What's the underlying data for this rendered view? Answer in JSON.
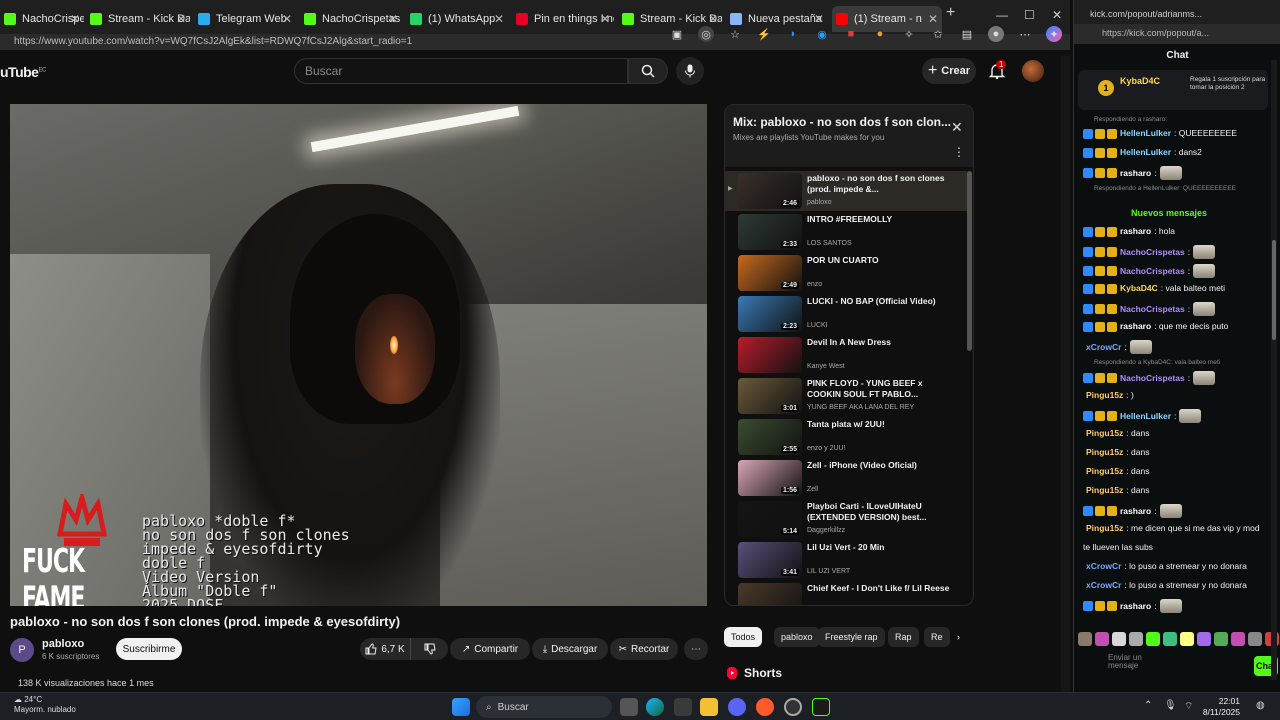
{
  "browser_left": {
    "tabs": [
      {
        "label": "NachoCrispetas Stre",
        "color": "#53fc18"
      },
      {
        "label": "Stream - Kick Dashb",
        "color": "#53fc18"
      },
      {
        "label": "Telegram Web",
        "color": "#2aabee"
      },
      {
        "label": "NachoCrispetas Stre",
        "color": "#53fc18"
      },
      {
        "label": "(1) WhatsApp",
        "color": "#25d366"
      },
      {
        "label": "Pin en things I need",
        "color": "#e60023"
      },
      {
        "label": "Stream - Kick Dashb",
        "color": "#53fc18"
      },
      {
        "label": "Nueva pestaña",
        "color": "#8ab4f8"
      },
      {
        "label": "(1) Stream - n",
        "color": "#ff0000"
      }
    ],
    "url": "https://www.youtube.com/watch?v=WQ7fCsJ2AlgEk&list=RDWQ7fCsJ2Alg&start_radio=1"
  },
  "youtube": {
    "logo": "uTube",
    "logo_region": "EC",
    "search_placeholder": "Buscar",
    "create_label": "Crear",
    "notif_count": "1",
    "video": {
      "overlay_text": "pabloxo *doble f*\nno son dos f son clones\nimpede & eyesofdirty\ndoble f\nVideo Version\nÁlbum \"Doble f\"\n2025 DOSF",
      "watermark": "FUCK FAME"
    },
    "title": "pabloxo - no son dos f son clones (prod. impede & eyesofdirty)",
    "channel": {
      "name": "pabloxo",
      "subs": "6 K suscriptores",
      "avatar_letter": "P"
    },
    "subscribe_label": "Suscribirme",
    "likes": "6,7 K",
    "share_label": "Compartir",
    "download_label": "Descargar",
    "clip_label": "Recortar",
    "views": "138 K visualizaciones  hace 1 mes",
    "playlist": {
      "title": "Mix: pabloxo - no son dos f son clon...",
      "subtitle": "Mixes are playlists YouTube makes for you",
      "items": [
        {
          "name": "pabloxo - no son dos f son clones (prod. impede &...",
          "channel": "pabloxo",
          "duration": "2:46",
          "bg": "#3a2f2a"
        },
        {
          "name": "INTRO #FREEMOLLY",
          "channel": "LOS SANTOS",
          "duration": "2:33",
          "bg": "#2e3a36"
        },
        {
          "name": "POR UN CUARTO",
          "channel": "enzo",
          "duration": "2:49",
          "bg": "#c76a1c"
        },
        {
          "name": "LUCKI - NO BAP (Official Video)",
          "channel": "LUCKI",
          "duration": "2:23",
          "bg": "#3a7ab5"
        },
        {
          "name": "Devil In A New Dress",
          "channel": "Kanye West",
          "duration": "",
          "bg": "#b81c2a"
        },
        {
          "name": "PINK FLOYD - YUNG BEEF x COOKIN SOUL FT PABLO...",
          "channel": "YUNG BEEF AKA LANA DEL REY",
          "duration": "3:01",
          "bg": "#6b5a3a"
        },
        {
          "name": "Tanta plata w/ 2UU!",
          "channel": "enzo y 2UU!",
          "duration": "2:55",
          "bg": "#3b4d2f"
        },
        {
          "name": "Zell - iPhone (Video Oficial)",
          "channel": "Zell",
          "duration": "1:56",
          "bg": "#d9a6b8"
        },
        {
          "name": "Playboi Carti - ILoveUIHateU (EXTENDED VERSION) best...",
          "channel": "Daggerkillzz",
          "duration": "5:14",
          "bg": "#141414"
        },
        {
          "name": "Lil Uzi Vert - 20 Min",
          "channel": "LIL UZI VERT",
          "duration": "3:41",
          "bg": "#5a4f7a"
        },
        {
          "name": "Chief Keef - I Don't Like f/ Lil Reese",
          "channel": "",
          "duration": "",
          "bg": "#4a3a2a"
        }
      ]
    },
    "chips": [
      "Todos",
      "pabloxo",
      "Freestyle rap",
      "Rap",
      "Re"
    ],
    "shorts_label": "Shorts"
  },
  "kick": {
    "tab_label": "kick.com/popout/adrianms...",
    "url": "https://kick.com/popout/a...",
    "chat_title": "Chat",
    "pinned": {
      "user": "KybaD4C",
      "text": "Regala 1 suscripción para tomar la posición 2",
      "rank": "1"
    },
    "new_messages_label": "Nuevos mensajes",
    "messages": [
      {
        "type": "reply",
        "text": "Respondiendo a rasharo:"
      },
      {
        "type": "msg",
        "user": "HellenLulker",
        "color": "#8ad6ff",
        "text": ": QUEEEEEEEE"
      },
      {
        "type": "msg",
        "user": "HellenLulker",
        "color": "#8ad6ff",
        "text": ": dans2"
      },
      {
        "type": "msg",
        "user": "rasharo",
        "color": "#ffffff",
        "text": ":",
        "emote": true
      },
      {
        "type": "reply",
        "text": "Respondiendo a HellenLulker: QUEEEEEEEEEE"
      },
      {
        "type": "msg",
        "user": "rasharo",
        "color": "#ffffff",
        "text": ": hola"
      },
      {
        "type": "msg",
        "user": "NachoCrispetas",
        "color": "#b38bff",
        "text": ":",
        "emote": true
      },
      {
        "type": "msg",
        "user": "NachoCrispetas",
        "color": "#b38bff",
        "text": ":",
        "emote": true
      },
      {
        "type": "msg",
        "user": "KybaD4C",
        "color": "#ffd94a",
        "text": ": vala balteo meti"
      },
      {
        "type": "msg",
        "user": "NachoCrispetas",
        "color": "#b38bff",
        "text": ":",
        "emote": true
      },
      {
        "type": "msg",
        "user": "rasharo",
        "color": "#ffffff",
        "text": ": que me decis puto"
      },
      {
        "type": "msg",
        "user": "xCrowCr",
        "color": "#7aa8ff",
        "text": ":",
        "emote": true
      },
      {
        "type": "reply",
        "text": "Respondiendo a KybaD4C: vala balteo meti"
      },
      {
        "type": "msg",
        "user": "NachoCrispetas",
        "color": "#b38bff",
        "text": ":",
        "emote": true
      },
      {
        "type": "msg",
        "user": "Pingu15z",
        "color": "#ffcc66",
        "text": ": )"
      },
      {
        "type": "msg",
        "user": "HellenLulker",
        "color": "#8ad6ff",
        "text": ":",
        "emote": true
      },
      {
        "type": "msg",
        "user": "Pingu15z",
        "color": "#ffcc66",
        "text": ": dans"
      },
      {
        "type": "msg",
        "user": "Pingu15z",
        "color": "#ffcc66",
        "text": ": dans"
      },
      {
        "type": "msg",
        "user": "Pingu15z",
        "color": "#ffcc66",
        "text": ": dans"
      },
      {
        "type": "msg",
        "user": "Pingu15z",
        "color": "#ffcc66",
        "text": ": dans"
      },
      {
        "type": "msg",
        "user": "rasharo",
        "color": "#ffffff",
        "text": ":",
        "emote": true
      },
      {
        "type": "msg",
        "user": "Pingu15z",
        "color": "#ffcc66",
        "text": ": me dicen que si me das vip y mod"
      },
      {
        "type": "cont",
        "text": "te llueven las subs"
      },
      {
        "type": "msg",
        "user": "xCrowCr",
        "color": "#7aa8ff",
        "text": ": lo puso a stremear y no donara"
      },
      {
        "type": "msg",
        "user": "xCrowCr",
        "color": "#7aa8ff",
        "text": ": lo puso a stremear y no donara"
      },
      {
        "type": "msg",
        "user": "rasharo",
        "color": "#ffffff",
        "text": ":",
        "emote": true
      }
    ],
    "input_placeholder": "Enviar un mensaje",
    "send_label": "Chat"
  },
  "taskbar": {
    "weather_temp": "24°C",
    "weather_desc": "Mayorm. nublado",
    "search_label": "Buscar",
    "time": "22:01",
    "date": "8/11/2025"
  }
}
